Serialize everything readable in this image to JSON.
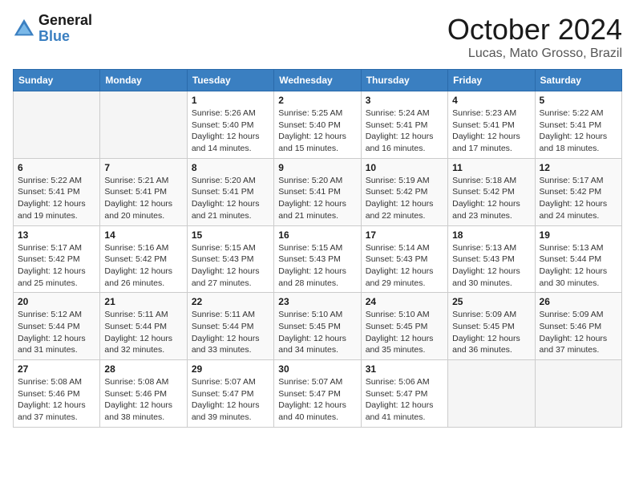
{
  "header": {
    "logo_line1": "General",
    "logo_line2": "Blue",
    "month": "October 2024",
    "location": "Lucas, Mato Grosso, Brazil"
  },
  "weekdays": [
    "Sunday",
    "Monday",
    "Tuesday",
    "Wednesday",
    "Thursday",
    "Friday",
    "Saturday"
  ],
  "weeks": [
    [
      {
        "day": "",
        "info": ""
      },
      {
        "day": "",
        "info": ""
      },
      {
        "day": "1",
        "info": "Sunrise: 5:26 AM\nSunset: 5:40 PM\nDaylight: 12 hours\nand 14 minutes."
      },
      {
        "day": "2",
        "info": "Sunrise: 5:25 AM\nSunset: 5:40 PM\nDaylight: 12 hours\nand 15 minutes."
      },
      {
        "day": "3",
        "info": "Sunrise: 5:24 AM\nSunset: 5:41 PM\nDaylight: 12 hours\nand 16 minutes."
      },
      {
        "day": "4",
        "info": "Sunrise: 5:23 AM\nSunset: 5:41 PM\nDaylight: 12 hours\nand 17 minutes."
      },
      {
        "day": "5",
        "info": "Sunrise: 5:22 AM\nSunset: 5:41 PM\nDaylight: 12 hours\nand 18 minutes."
      }
    ],
    [
      {
        "day": "6",
        "info": "Sunrise: 5:22 AM\nSunset: 5:41 PM\nDaylight: 12 hours\nand 19 minutes."
      },
      {
        "day": "7",
        "info": "Sunrise: 5:21 AM\nSunset: 5:41 PM\nDaylight: 12 hours\nand 20 minutes."
      },
      {
        "day": "8",
        "info": "Sunrise: 5:20 AM\nSunset: 5:41 PM\nDaylight: 12 hours\nand 21 minutes."
      },
      {
        "day": "9",
        "info": "Sunrise: 5:20 AM\nSunset: 5:41 PM\nDaylight: 12 hours\nand 21 minutes."
      },
      {
        "day": "10",
        "info": "Sunrise: 5:19 AM\nSunset: 5:42 PM\nDaylight: 12 hours\nand 22 minutes."
      },
      {
        "day": "11",
        "info": "Sunrise: 5:18 AM\nSunset: 5:42 PM\nDaylight: 12 hours\nand 23 minutes."
      },
      {
        "day": "12",
        "info": "Sunrise: 5:17 AM\nSunset: 5:42 PM\nDaylight: 12 hours\nand 24 minutes."
      }
    ],
    [
      {
        "day": "13",
        "info": "Sunrise: 5:17 AM\nSunset: 5:42 PM\nDaylight: 12 hours\nand 25 minutes."
      },
      {
        "day": "14",
        "info": "Sunrise: 5:16 AM\nSunset: 5:42 PM\nDaylight: 12 hours\nand 26 minutes."
      },
      {
        "day": "15",
        "info": "Sunrise: 5:15 AM\nSunset: 5:43 PM\nDaylight: 12 hours\nand 27 minutes."
      },
      {
        "day": "16",
        "info": "Sunrise: 5:15 AM\nSunset: 5:43 PM\nDaylight: 12 hours\nand 28 minutes."
      },
      {
        "day": "17",
        "info": "Sunrise: 5:14 AM\nSunset: 5:43 PM\nDaylight: 12 hours\nand 29 minutes."
      },
      {
        "day": "18",
        "info": "Sunrise: 5:13 AM\nSunset: 5:43 PM\nDaylight: 12 hours\nand 30 minutes."
      },
      {
        "day": "19",
        "info": "Sunrise: 5:13 AM\nSunset: 5:44 PM\nDaylight: 12 hours\nand 30 minutes."
      }
    ],
    [
      {
        "day": "20",
        "info": "Sunrise: 5:12 AM\nSunset: 5:44 PM\nDaylight: 12 hours\nand 31 minutes."
      },
      {
        "day": "21",
        "info": "Sunrise: 5:11 AM\nSunset: 5:44 PM\nDaylight: 12 hours\nand 32 minutes."
      },
      {
        "day": "22",
        "info": "Sunrise: 5:11 AM\nSunset: 5:44 PM\nDaylight: 12 hours\nand 33 minutes."
      },
      {
        "day": "23",
        "info": "Sunrise: 5:10 AM\nSunset: 5:45 PM\nDaylight: 12 hours\nand 34 minutes."
      },
      {
        "day": "24",
        "info": "Sunrise: 5:10 AM\nSunset: 5:45 PM\nDaylight: 12 hours\nand 35 minutes."
      },
      {
        "day": "25",
        "info": "Sunrise: 5:09 AM\nSunset: 5:45 PM\nDaylight: 12 hours\nand 36 minutes."
      },
      {
        "day": "26",
        "info": "Sunrise: 5:09 AM\nSunset: 5:46 PM\nDaylight: 12 hours\nand 37 minutes."
      }
    ],
    [
      {
        "day": "27",
        "info": "Sunrise: 5:08 AM\nSunset: 5:46 PM\nDaylight: 12 hours\nand 37 minutes."
      },
      {
        "day": "28",
        "info": "Sunrise: 5:08 AM\nSunset: 5:46 PM\nDaylight: 12 hours\nand 38 minutes."
      },
      {
        "day": "29",
        "info": "Sunrise: 5:07 AM\nSunset: 5:47 PM\nDaylight: 12 hours\nand 39 minutes."
      },
      {
        "day": "30",
        "info": "Sunrise: 5:07 AM\nSunset: 5:47 PM\nDaylight: 12 hours\nand 40 minutes."
      },
      {
        "day": "31",
        "info": "Sunrise: 5:06 AM\nSunset: 5:47 PM\nDaylight: 12 hours\nand 41 minutes."
      },
      {
        "day": "",
        "info": ""
      },
      {
        "day": "",
        "info": ""
      }
    ]
  ]
}
